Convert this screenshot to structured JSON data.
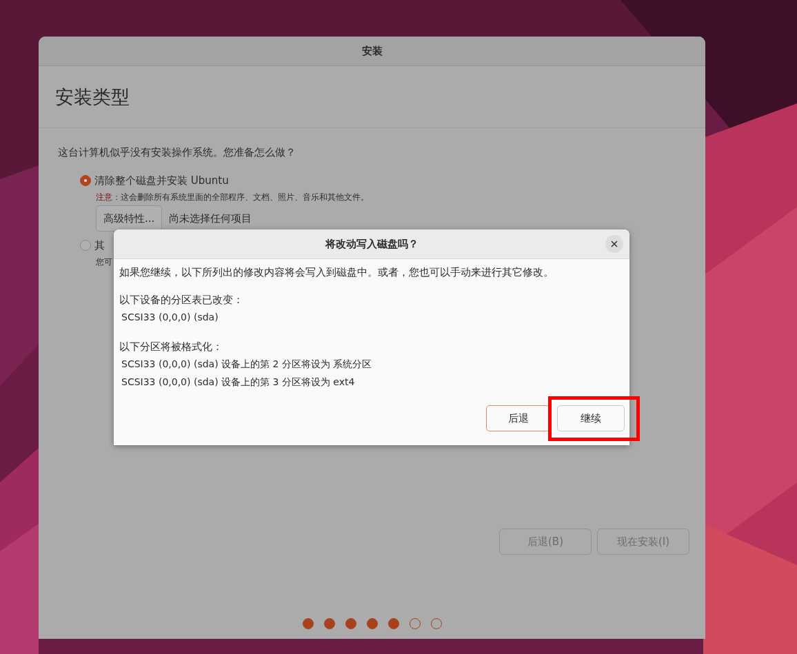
{
  "window": {
    "title": "安装"
  },
  "page": {
    "heading": "安装类型",
    "question": "这台计算机似乎没有安装操作系统。您准备怎么做？",
    "options": [
      {
        "label": "清除整个磁盘并安装 Ubuntu",
        "selected": true,
        "warning_label": "注意：",
        "warning": "这会删除所有系统里面的全部程序、文档、照片、音乐和其他文件。",
        "button": "高级特性...",
        "status": "尚未选择任何项目"
      },
      {
        "label": "其",
        "selected": false,
        "note": "您可"
      }
    ],
    "buttons": [
      {
        "label": "后退(B)"
      },
      {
        "label": "现在安装(I)"
      }
    ],
    "steps": [
      {
        "done": true
      },
      {
        "done": true
      },
      {
        "done": true
      },
      {
        "done": true
      },
      {
        "done": true
      },
      {
        "done": false
      },
      {
        "done": false
      }
    ]
  },
  "dialog": {
    "title": "将改动写入磁盘吗？",
    "intro": "如果您继续，以下所列出的修改内容将会写入到磁盘中。或者，您也可以手动来进行其它修改。",
    "sections": [
      {
        "heading": "以下设备的分区表已改变：",
        "items": [
          "SCSI33 (0,0,0) (sda)"
        ]
      },
      {
        "heading": "以下分区将被格式化：",
        "items": [
          "SCSI33 (0,0,0) (sda) 设备上的第 2 分区将设为 系统分区",
          "SCSI33 (0,0,0) (sda) 设备上的第 3 分区将设为 ext4"
        ]
      }
    ],
    "buttons": [
      {
        "label": "后退",
        "kind": "outlined"
      },
      {
        "label": "继续",
        "kind": "plain",
        "highlighted": true
      }
    ]
  }
}
